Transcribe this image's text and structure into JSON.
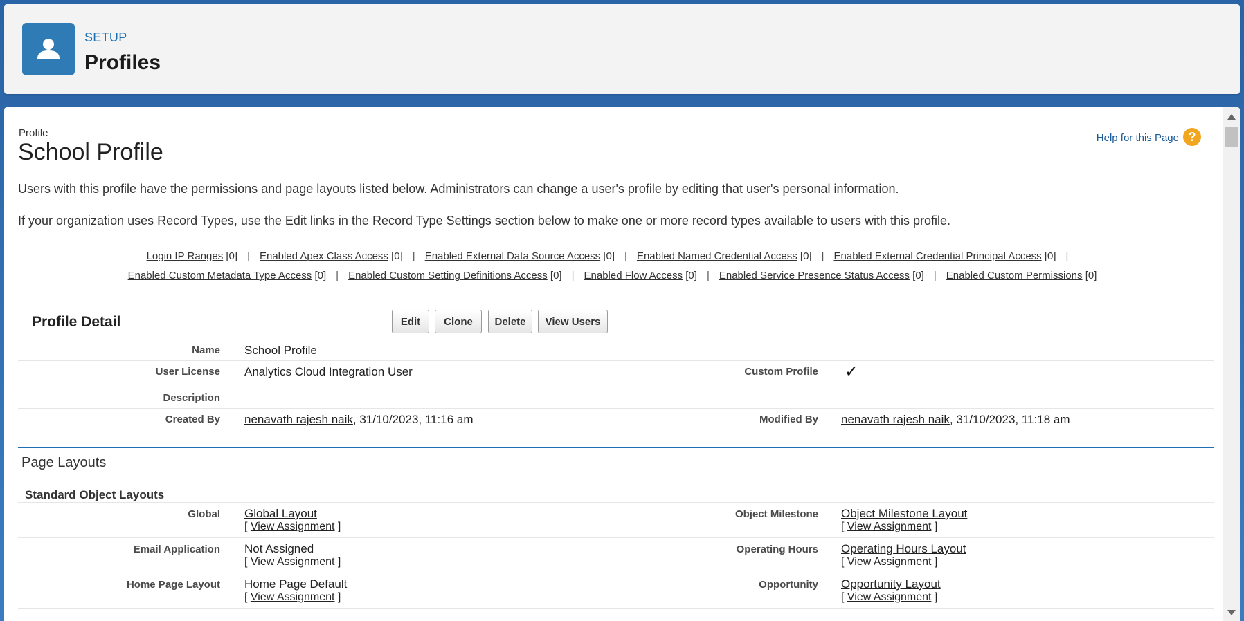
{
  "header": {
    "eyebrow": "SETUP",
    "title": "Profiles",
    "icon": "user-icon",
    "accent": "#2e7bb5"
  },
  "page": {
    "eyebrow": "Profile",
    "title": "School Profile",
    "help_label": "Help for this Page",
    "help_icon": "?",
    "intro_1": "Users with this profile have the permissions and page layouts listed below. Administrators can change a user's profile by editing that user's personal information.",
    "intro_2": "If your organization uses Record Types, use the Edit links in the Record Type Settings section below to make one or more record types available to users with this profile."
  },
  "links_row_1": [
    {
      "label": "Login IP Ranges",
      "count": "[0]"
    },
    {
      "label": "Enabled Apex Class Access",
      "count": "[0]"
    },
    {
      "label": "Enabled External Data Source Access",
      "count": "[0]"
    },
    {
      "label": "Enabled Named Credential Access",
      "count": "[0]"
    },
    {
      "label": "Enabled External Credential Principal Access",
      "count": "[0]"
    }
  ],
  "links_row_2": [
    {
      "label": "Enabled Custom Metadata Type Access",
      "count": "[0]"
    },
    {
      "label": "Enabled Custom Setting Definitions Access",
      "count": "[0]"
    },
    {
      "label": "Enabled Flow Access",
      "count": "[0]"
    },
    {
      "label": "Enabled Service Presence Status Access",
      "count": "[0]"
    },
    {
      "label": "Enabled Custom Permissions",
      "count": "[0]"
    }
  ],
  "detail": {
    "title": "Profile Detail",
    "buttons": {
      "edit": "Edit",
      "clone": "Clone",
      "delete": "Delete",
      "view_users": "View Users"
    },
    "name_label": "Name",
    "name_value": "School Profile",
    "license_label": "User License",
    "license_value": "Analytics Cloud Integration User",
    "custom_label": "Custom Profile",
    "custom_value": "✓",
    "description_label": "Description",
    "created_label": "Created By",
    "created_user": "nenavath rajesh naik",
    "created_date": ", 31/10/2023, 11:16 am",
    "modified_label": "Modified By",
    "modified_user": "nenavath rajesh naik",
    "modified_date": ", 31/10/2023, 11:18 am"
  },
  "layouts": {
    "title": "Page Layouts",
    "standard_title": "Standard Object Layouts",
    "view_assignment": "View Assignment",
    "rows": [
      {
        "left_label": "Global",
        "left_value": "Global Layout",
        "left_link": true,
        "right_label": "Object Milestone",
        "right_value": "Object Milestone Layout",
        "right_link": true
      },
      {
        "left_label": "Email Application",
        "left_value": "Not Assigned",
        "left_link": false,
        "right_label": "Operating Hours",
        "right_value": "Operating Hours Layout",
        "right_link": true
      },
      {
        "left_label": "Home Page Layout",
        "left_value": "Home Page Default",
        "left_link": false,
        "right_label": "Opportunity",
        "right_value": "Opportunity Layout",
        "right_link": true
      }
    ]
  }
}
